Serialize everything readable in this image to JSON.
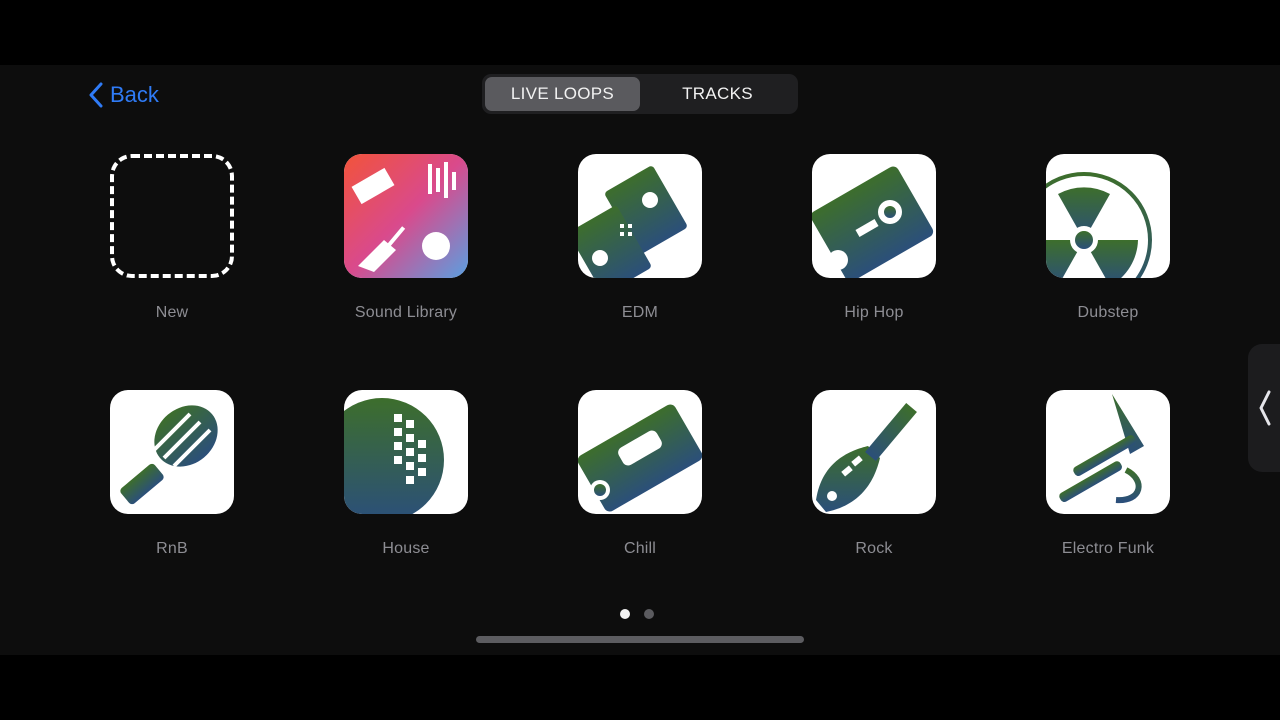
{
  "nav": {
    "back_label": "Back"
  },
  "segmented": {
    "tabs": [
      "LIVE LOOPS",
      "TRACKS"
    ],
    "selected": "LIVE LOOPS"
  },
  "grid": {
    "tiles": [
      {
        "label": "New",
        "icon": "new-dashed-icon"
      },
      {
        "label": "Sound Library",
        "icon": "sound-library-icon"
      },
      {
        "label": "EDM",
        "icon": "edm-icon"
      },
      {
        "label": "Hip Hop",
        "icon": "hip-hop-boombox-icon"
      },
      {
        "label": "Dubstep",
        "icon": "dubstep-icon"
      },
      {
        "label": "RnB",
        "icon": "microphone-icon"
      },
      {
        "label": "House",
        "icon": "disco-ball-icon"
      },
      {
        "label": "Chill",
        "icon": "cassette-icon"
      },
      {
        "label": "Rock",
        "icon": "guitar-icon"
      },
      {
        "label": "Electro Funk",
        "icon": "trumpet-icon"
      }
    ]
  },
  "pagination": {
    "current_page": 1,
    "total_pages": 2
  },
  "colors": {
    "accent": "#2f7bf6",
    "icon_gradient_top": "#3a6b2f",
    "icon_gradient_bottom": "#2d4f78"
  }
}
